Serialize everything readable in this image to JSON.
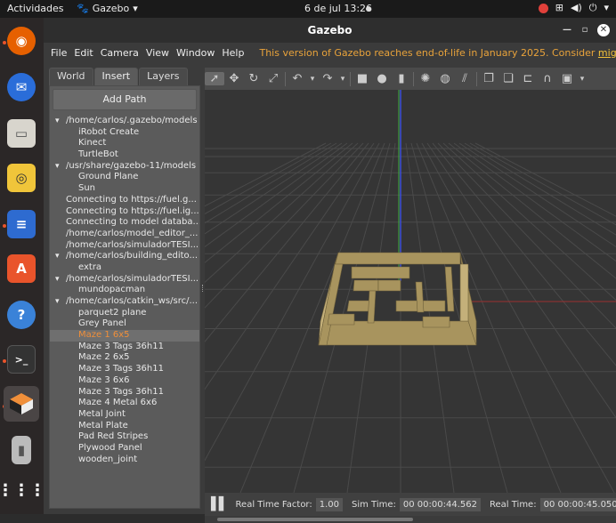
{
  "topbar": {
    "activities": "Actividades",
    "app_name": "Gazebo",
    "clock": "6 de jul  13:26"
  },
  "window": {
    "title": "Gazebo"
  },
  "menu": {
    "items": [
      "File",
      "Edit",
      "Camera",
      "View",
      "Window",
      "Help"
    ],
    "eol_notice": "This version of Gazebo reaches end-of-life in January 2025. Consider",
    "eol_link": "migrating to the new"
  },
  "left_panel": {
    "tabs": [
      "World",
      "Insert",
      "Layers"
    ],
    "active_tab": "Insert",
    "add_path_label": "Add Path",
    "tree": [
      {
        "level": 0,
        "text": "/home/carlos/.gazebo/models"
      },
      {
        "level": 1,
        "text": "iRobot Create"
      },
      {
        "level": 1,
        "text": "Kinect"
      },
      {
        "level": 1,
        "text": "TurtleBot"
      },
      {
        "level": 0,
        "text": "/usr/share/gazebo-11/models"
      },
      {
        "level": 1,
        "text": "Ground Plane"
      },
      {
        "level": 1,
        "text": "Sun"
      },
      {
        "level": 0,
        "text": "Connecting to https://fuel.g...",
        "nochev": true
      },
      {
        "level": 0,
        "text": "Connecting to https://fuel.ig...",
        "nochev": true
      },
      {
        "level": 0,
        "text": "Connecting to model databa...",
        "nochev": true
      },
      {
        "level": 0,
        "text": "/home/carlos/model_editor_...",
        "nochev": true
      },
      {
        "level": 0,
        "text": "/home/carlos/simuladorTESI...",
        "nochev": true
      },
      {
        "level": 0,
        "text": "/home/carlos/building_edito..."
      },
      {
        "level": 1,
        "text": "extra"
      },
      {
        "level": 0,
        "text": "/home/carlos/simuladorTESI..."
      },
      {
        "level": 1,
        "text": "mundopacman"
      },
      {
        "level": 0,
        "text": "/home/carlos/catkin_ws/src/..."
      },
      {
        "level": 1,
        "text": "parquet2 plane"
      },
      {
        "level": 1,
        "text": "Grey Panel"
      },
      {
        "level": 1,
        "text": "Maze 1 6x5",
        "selected": true
      },
      {
        "level": 1,
        "text": "Maze 3 Tags 36h11"
      },
      {
        "level": 1,
        "text": "Maze 2 6x5"
      },
      {
        "level": 1,
        "text": "Maze 3 Tags 36h11"
      },
      {
        "level": 1,
        "text": "Maze 3 6x6"
      },
      {
        "level": 1,
        "text": "Maze 3 Tags 36h11"
      },
      {
        "level": 1,
        "text": "Maze 4 Metal 6x6"
      },
      {
        "level": 1,
        "text": "Metal Joint"
      },
      {
        "level": 1,
        "text": "Metal Plate"
      },
      {
        "level": 1,
        "text": "Pad Red Stripes"
      },
      {
        "level": 1,
        "text": "Plywood Panel"
      },
      {
        "level": 1,
        "text": "wooden_joint"
      }
    ]
  },
  "bottom_bar": {
    "rtf_label": "Real Time Factor:",
    "rtf_value": "1.00",
    "sim_label": "Sim Time:",
    "sim_value": "00 00:00:44.562",
    "real_label": "Real Time:",
    "real_value": "00 00:00:45.050",
    "trailing": "It"
  },
  "colors": {
    "accent_selected": "#f08f3a",
    "eol_text": "#e9a33b",
    "maze_wall": "#a8945e",
    "grid": "#4a4a4a",
    "z_axis": "#3b4fd9",
    "y_axis": "#3fae3f"
  }
}
